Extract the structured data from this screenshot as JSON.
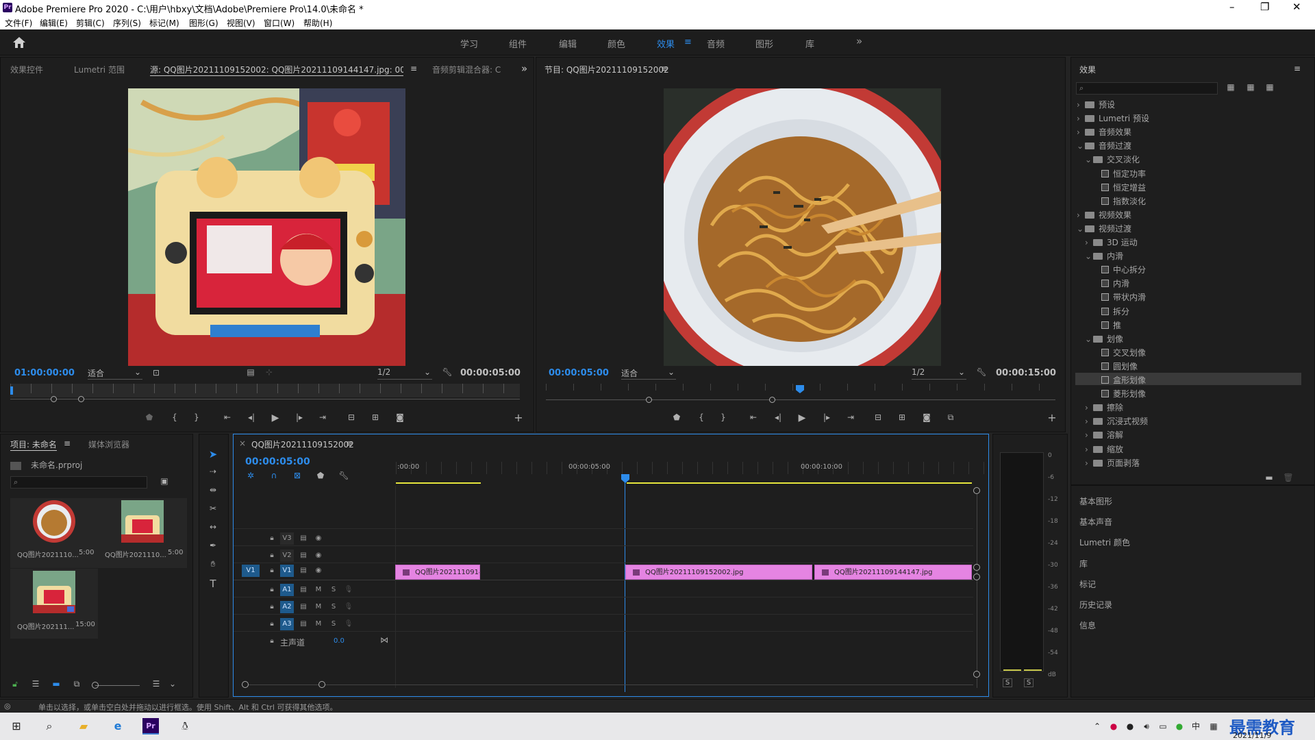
{
  "window": {
    "title": "Adobe Premiere Pro 2020 - C:\\用户\\hbxy\\文档\\Adobe\\Premiere Pro\\14.0\\未命名 *",
    "app_icon": "Pr",
    "minimize": "–",
    "maximize": "❐",
    "close": "✕"
  },
  "menu": [
    "文件(F)",
    "编辑(E)",
    "剪辑(C)",
    "序列(S)",
    "标记(M)",
    "图形(G)",
    "视图(V)",
    "窗口(W)",
    "帮助(H)"
  ],
  "workspaces": [
    "学习",
    "组件",
    "编辑",
    "颜色",
    "效果",
    "音频",
    "图形",
    "库"
  ],
  "workspace_active": "效果",
  "source_panel": {
    "tabs": [
      "效果控件",
      "Lumetri 范围",
      "源: QQ图片20211109152002: QQ图片20211109144147.jpg: 00:00:10:00",
      "音频剪辑混合器: C"
    ],
    "timecode": "01:00:00:00",
    "fit": "适合",
    "resolution": "1/2",
    "duration": "00:00:05:00"
  },
  "program_panel": {
    "tab": "节目: QQ图片20211109152002",
    "timecode": "00:00:05:00",
    "fit": "适合",
    "resolution": "1/2",
    "duration": "00:00:15:00"
  },
  "effects_panel": {
    "title": "效果",
    "tree": [
      {
        "label": "预设",
        "level": 0,
        "kind": "folder",
        "expanded": false
      },
      {
        "label": "Lumetri 预设",
        "level": 0,
        "kind": "folder",
        "expanded": false
      },
      {
        "label": "音频效果",
        "level": 0,
        "kind": "folder",
        "expanded": false
      },
      {
        "label": "音频过渡",
        "level": 0,
        "kind": "folder",
        "expanded": true
      },
      {
        "label": "交叉淡化",
        "level": 1,
        "kind": "folder",
        "expanded": true
      },
      {
        "label": "恒定功率",
        "level": 2,
        "kind": "fx"
      },
      {
        "label": "恒定增益",
        "level": 2,
        "kind": "fx"
      },
      {
        "label": "指数淡化",
        "level": 2,
        "kind": "fx"
      },
      {
        "label": "视频效果",
        "level": 0,
        "kind": "folder",
        "expanded": false
      },
      {
        "label": "视频过渡",
        "level": 0,
        "kind": "folder",
        "expanded": true
      },
      {
        "label": "3D 运动",
        "level": 1,
        "kind": "folder",
        "expanded": false
      },
      {
        "label": "内滑",
        "level": 1,
        "kind": "folder",
        "expanded": true
      },
      {
        "label": "中心拆分",
        "level": 2,
        "kind": "fx"
      },
      {
        "label": "内滑",
        "level": 2,
        "kind": "fx"
      },
      {
        "label": "带状内滑",
        "level": 2,
        "kind": "fx"
      },
      {
        "label": "拆分",
        "level": 2,
        "kind": "fx"
      },
      {
        "label": "推",
        "level": 2,
        "kind": "fx"
      },
      {
        "label": "划像",
        "level": 1,
        "kind": "folder",
        "expanded": true
      },
      {
        "label": "交叉划像",
        "level": 2,
        "kind": "fx"
      },
      {
        "label": "圆划像",
        "level": 2,
        "kind": "fx"
      },
      {
        "label": "盒形划像",
        "level": 2,
        "kind": "fx",
        "selected": true
      },
      {
        "label": "菱形划像",
        "level": 2,
        "kind": "fx"
      },
      {
        "label": "擦除",
        "level": 1,
        "kind": "folder",
        "expanded": false
      },
      {
        "label": "沉浸式视频",
        "level": 1,
        "kind": "folder",
        "expanded": false
      },
      {
        "label": "溶解",
        "level": 1,
        "kind": "folder",
        "expanded": false
      },
      {
        "label": "缩放",
        "level": 1,
        "kind": "folder",
        "expanded": false
      },
      {
        "label": "页面剥落",
        "level": 1,
        "kind": "folder",
        "expanded": false
      }
    ],
    "sub_panels": [
      "基本图形",
      "基本声音",
      "Lumetri 颜色",
      "库",
      "标记",
      "历史记录",
      "信息"
    ]
  },
  "project_panel": {
    "tabs": [
      "项目: 未命名",
      "媒体浏览器"
    ],
    "file": "未命名.prproj",
    "items": [
      {
        "name": "QQ图片2021110...",
        "duration": "5:00"
      },
      {
        "name": "QQ图片2021110...",
        "duration": "5:00"
      },
      {
        "name": "QQ图片202111...",
        "duration": "15:00"
      }
    ]
  },
  "timeline": {
    "tab": "QQ图片20211109152002",
    "timecode": "00:00:05:00",
    "ruler": [
      ":00:00",
      "00:00:05:00",
      "00:00:10:00"
    ],
    "video_tracks": [
      "V3",
      "V2",
      "V1"
    ],
    "audio_tracks": [
      "A1",
      "A2",
      "A3"
    ],
    "source_patch": "V1",
    "master": "主声道",
    "master_value": "0.0",
    "clips": [
      "QQ图片2021110914",
      "QQ图片20211109152002.jpg",
      "QQ图片20211109144147.jpg"
    ]
  },
  "meter": {
    "scale": [
      "0",
      "-6",
      "-12",
      "-18",
      "-24",
      "-30",
      "-36",
      "-42",
      "-48",
      "-54",
      "dB"
    ],
    "solo": [
      "S",
      "S"
    ]
  },
  "status": "单击以选择，或单击空白处并拖动以进行框选。使用 Shift、Alt 和 Ctrl 可获得其他选项。",
  "taskbar": {
    "ime": "中",
    "date": "2021/11/9",
    "watermark": "最需教育"
  }
}
